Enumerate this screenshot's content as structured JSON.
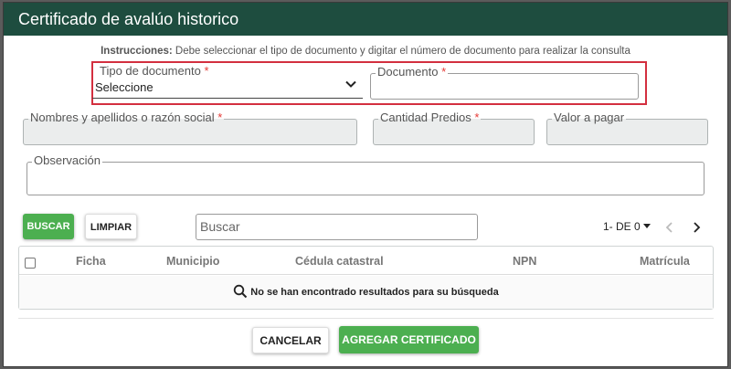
{
  "dialog": {
    "title": "Certificado de avalúo historico",
    "instructions_label": "Instrucciones:",
    "instructions_text": " Debe seleccionar el tipo de documento y digitar el número de documento para realizar la consulta"
  },
  "form": {
    "tipo_documento": {
      "label": "Tipo de documento",
      "required": "*",
      "value": "Seleccione"
    },
    "documento": {
      "label": "Documento",
      "required": "*",
      "value": ""
    },
    "nombres": {
      "label": "Nombres y apellidos o razón social",
      "required": "*",
      "value": ""
    },
    "cantidad_predios": {
      "label": "Cantidad Predios",
      "required": "*",
      "value": ""
    },
    "valor_pagar": {
      "label": "Valor a pagar",
      "value": ""
    },
    "observacion": {
      "label": "Observación",
      "value": ""
    }
  },
  "toolbar": {
    "buscar_label": "BUSCAR",
    "limpiar_label": "LIMPIAR",
    "search_placeholder": "Buscar",
    "pager_label": "1- DE 0"
  },
  "table": {
    "columns": [
      "Ficha",
      "Municipio",
      "Cédula catastral",
      "NPN",
      "Matrícula"
    ],
    "empty_message": "No se han encontrado resultados para su búsqueda"
  },
  "footer": {
    "cancel_label": "CANCELAR",
    "add_label": "AGREGAR CERTIFICADO"
  },
  "colors": {
    "header_bg": "#1e4d3f",
    "primary": "#4caf50",
    "required": "#e53935",
    "highlight": "#d32f3f"
  }
}
